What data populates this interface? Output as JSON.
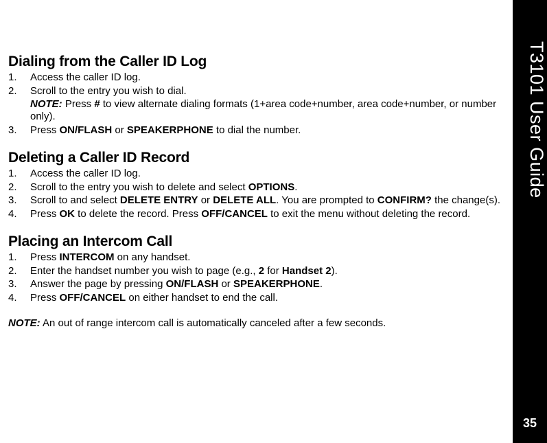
{
  "sidebar": {
    "title": "T3101 User Guide",
    "page_num": "35"
  },
  "s1": {
    "heading": "Dialing from the Caller ID Log",
    "i1_num": "1.",
    "i1": "Access the caller ID log.",
    "i2_num": "2.",
    "i2": "Scroll to the entry you wish to dial.",
    "i2_note_label": "NOTE:",
    "i2_note_a": " Press ",
    "i2_note_key": "#",
    "i2_note_b": " to view alternate dialing formats (1+area code+number, area code+number, or number only).",
    "i3_num": "3.",
    "i3_a": "Press ",
    "i3_k1": "ON/FLASH",
    "i3_b": " or ",
    "i3_k2": "SPEAKERPHONE",
    "i3_c": " to dial the number."
  },
  "s2": {
    "heading": "Deleting a Caller ID Record",
    "i1_num": "1.",
    "i1": "Access the caller ID log.",
    "i2_num": "2.",
    "i2_a": "Scroll to the entry you wish to delete and select ",
    "i2_k1": "OPTIONS",
    "i2_b": ".",
    "i3_num": "3.",
    "i3_a": "Scroll to and select ",
    "i3_k1": "DELETE ENTRY",
    "i3_b": " or ",
    "i3_k2": "DELETE ALL",
    "i3_c": ". You are prompted to ",
    "i3_k3": "CONFIRM?",
    "i3_d": " the change(s).",
    "i4_num": "4.",
    "i4_a": "Press ",
    "i4_k1": "OK",
    "i4_b": " to delete the record. Press ",
    "i4_k2": "OFF/CANCEL",
    "i4_c": " to exit the menu without deleting the record."
  },
  "s3": {
    "heading": "Placing an Intercom Call",
    "i1_num": "1.",
    "i1_a": "Press ",
    "i1_k1": "INTERCOM",
    "i1_b": " on any handset.",
    "i2_num": "2.",
    "i2_a": "Enter the handset number you wish to page (e.g., ",
    "i2_k1": "2",
    "i2_b": " for ",
    "i2_k2": "Handset 2",
    "i2_c": ").",
    "i3_num": "3.",
    "i3_a": "Answer the page by pressing ",
    "i3_k1": "ON/FLASH",
    "i3_b": " or ",
    "i3_k2": "SPEAKERPHONE",
    "i3_c": ".",
    "i4_num": "4.",
    "i4_a": "Press ",
    "i4_k1": "OFF/CANCEL",
    "i4_b": " on either handset to end the call."
  },
  "footnote": {
    "label": "NOTE:",
    "text": " An out of range intercom call is automatically canceled after a few seconds."
  }
}
